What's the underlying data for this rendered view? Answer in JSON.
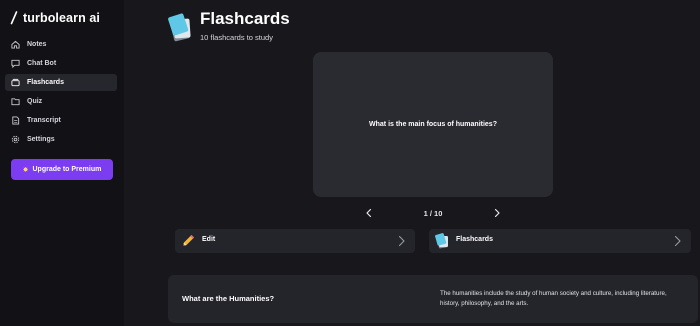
{
  "app": {
    "name": "turbolearn ai"
  },
  "sidebar": {
    "items": [
      {
        "label": "Notes",
        "icon": "home-icon",
        "active": false
      },
      {
        "label": "Chat Bot",
        "icon": "chat-icon",
        "active": false
      },
      {
        "label": "Flashcards",
        "icon": "cards-icon",
        "active": true
      },
      {
        "label": "Quiz",
        "icon": "folder-icon",
        "active": false
      },
      {
        "label": "Transcript",
        "icon": "document-icon",
        "active": false
      },
      {
        "label": "Settings",
        "icon": "gear-icon",
        "active": false
      }
    ],
    "upgrade_label": "Upgrade to Premium"
  },
  "header": {
    "title": "Flashcards",
    "subtitle": "10 flashcards to study"
  },
  "flashcard": {
    "question": "What is the main focus of humanities?",
    "pager": "1 / 10"
  },
  "actions": {
    "edit_label": "Edit",
    "flashcards_label": "Flashcards"
  },
  "qa": {
    "question": "What are the Humanities?",
    "answer": "The humanities include the study of human society and culture, including literature, history, philosophy, and the arts."
  },
  "colors": {
    "background": "#17171c",
    "sidebar": "#121216",
    "accent": "#7b3cf2",
    "card": "#2a2a31",
    "panel": "#24242b"
  }
}
